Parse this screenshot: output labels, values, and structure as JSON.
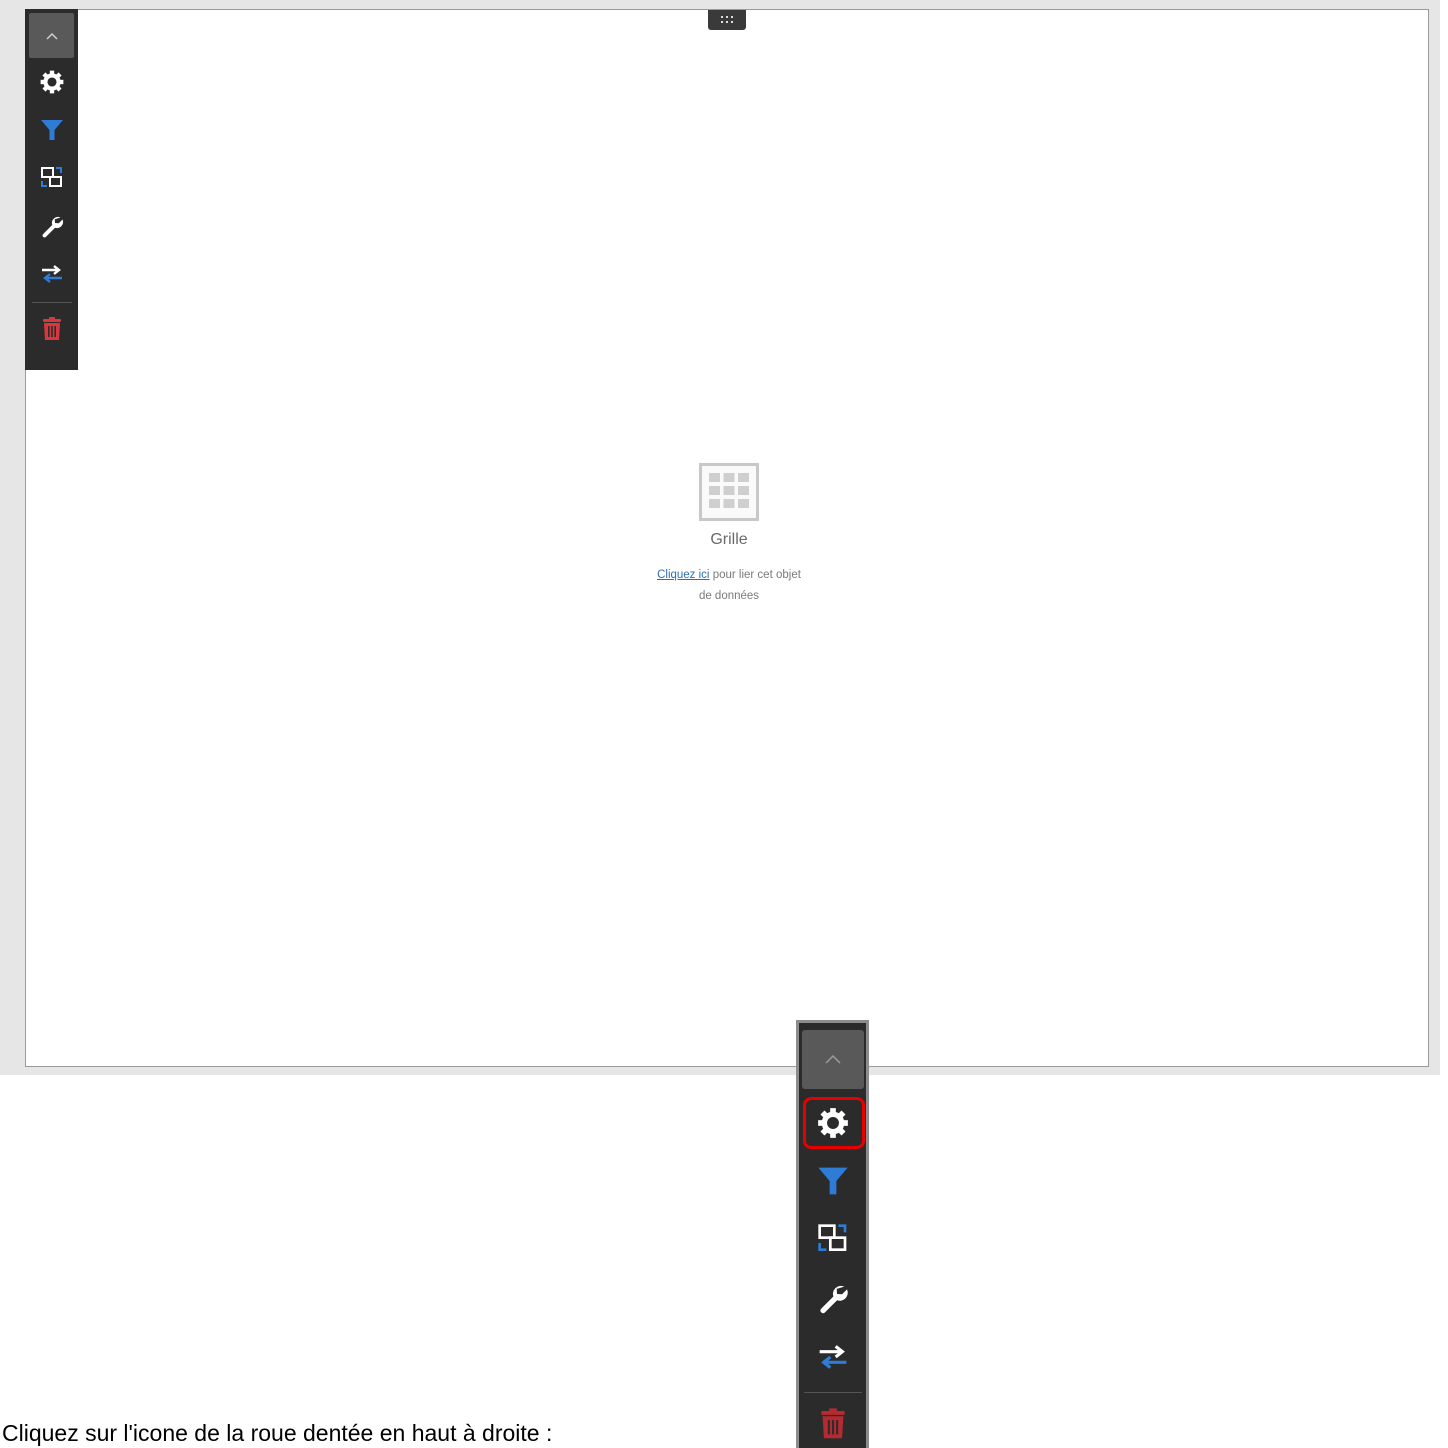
{
  "placeholder": {
    "title": "Grille",
    "link_text": "Cliquez ici",
    "text_line1_rest": " pour lier cet objet",
    "text_line2": "de données"
  },
  "toolbar": {
    "items": [
      {
        "icon": "chevron-up-icon",
        "color": "#cfcfcf"
      },
      {
        "icon": "gear-icon",
        "color": "#ffffff"
      },
      {
        "icon": "filter-icon",
        "color": "#2e7cd6"
      },
      {
        "icon": "interactions-icon",
        "color": "#ffffff"
      },
      {
        "icon": "wrench-icon",
        "color": "#ffffff"
      },
      {
        "icon": "swap-arrows-icon",
        "color": "#2e7cd6"
      },
      {
        "icon": "trash-icon",
        "color": "#d9363e"
      }
    ],
    "highlight_color": "#e60000"
  },
  "caption": "Cliquez sur l'icone de la roue dentée en haut  à droite :"
}
